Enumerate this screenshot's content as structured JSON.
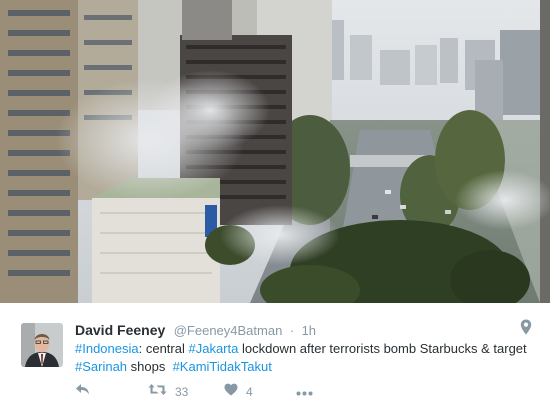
{
  "tweet": {
    "author_name": "David Feeney",
    "handle": "@Feeney4Batman",
    "separator": "·",
    "time": "1h",
    "text": {
      "hashtag_1": "#Indonesia",
      "text_1": ": central ",
      "hashtag_2": "#Jakarta",
      "text_2": " lockdown after terrorists bomb Starbucks & target",
      "hashtag_3": "#Sarinah",
      "text_3": " shops  ",
      "hashtag_4": "#KamiTidakTakut"
    },
    "retweet_count": "33",
    "like_count": "4"
  },
  "icons": {
    "reply": "reply-arrow",
    "retweet": "retweet-arrows",
    "like": "heart",
    "more": "ellipsis",
    "location": "map-pin"
  },
  "colors": {
    "link": "#1b95e0",
    "text": "#292f33",
    "muted": "#8899a6"
  }
}
